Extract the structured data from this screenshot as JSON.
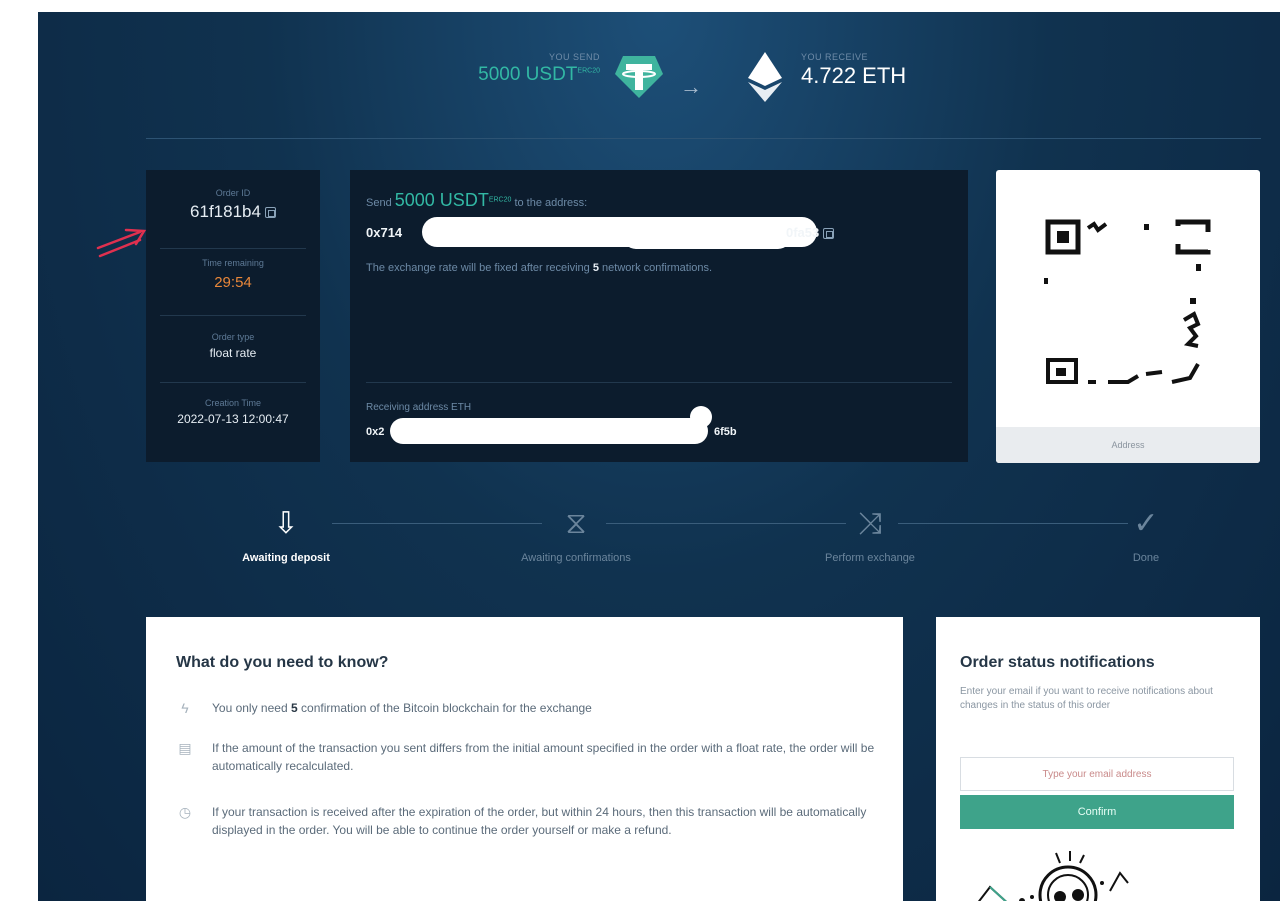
{
  "header": {
    "send_caption": "YOU SEND",
    "send_amount": "5000 USDT",
    "send_network": "ERC20",
    "send_address": "",
    "receive_caption": "YOU RECEIVE",
    "receive_amount": "4.722 ETH",
    "receive_address": ""
  },
  "order": {
    "id_caption": "Order ID",
    "id_value": "61f181b4",
    "time_caption": "Time remaining",
    "time_value": "29:54",
    "type_caption": "Order type",
    "type_value": "float rate",
    "created_caption": "Creation Time",
    "created_value": "2022-07-13 12:00:47"
  },
  "deposit": {
    "send_prefix": "Send",
    "send_amount": "5000 USDT",
    "send_network": "ERC20",
    "send_suffix": "to the address:",
    "address_start": "0x714",
    "address_end": "0fa53",
    "note_prefix": "The exchange rate will be fixed after receiving",
    "note_count": "5",
    "note_suffix": "network confirmations.",
    "receiving_caption": "Receiving address ETH",
    "receiving_start": "0x2",
    "receiving_end": "6f5b"
  },
  "qr": {
    "footer_label": "Address"
  },
  "steps": [
    {
      "label": "Awaiting deposit",
      "icon": "download-icon",
      "active": true
    },
    {
      "label": "Awaiting confirmations",
      "icon": "hourglass-icon",
      "active": false
    },
    {
      "label": "Perform exchange",
      "icon": "shuffle-icon",
      "active": false
    },
    {
      "label": "Done",
      "icon": "check-icon",
      "active": false
    }
  ],
  "know": {
    "title": "What do you need to know?",
    "item1_prefix": "You only need",
    "item1_count": "5",
    "item1_suffix": "confirmation of the Bitcoin blockchain for the exchange",
    "item2": "If the amount of the transaction you sent differs from the initial amount specified in the order with a float rate, the order will be automatically recalculated.",
    "item3": "If your transaction is received after the expiration of the order, but within 24 hours, then this transaction will be automatically displayed in the order. You will be able to continue the order yourself or make a refund."
  },
  "notifications": {
    "title": "Order status notifications",
    "description": "Enter your email if you want to receive notifications about changes in the status of this order",
    "email_placeholder": "Type your email address",
    "confirm_label": "Confirm"
  },
  "colors": {
    "accent_teal": "#32b8a4",
    "timer_orange": "#e8873a",
    "confirm_green": "#3ea38a",
    "annotation_red": "#e0304f"
  }
}
